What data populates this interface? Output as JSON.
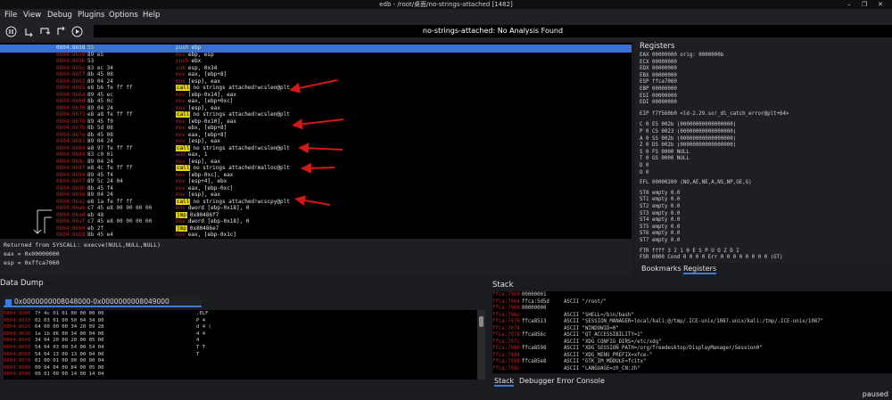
{
  "window": {
    "title": "edb - /root/桌面/no-strings-attached [1482]",
    "minimize": "–",
    "restore": "❐",
    "close": "✕"
  },
  "menu": [
    "File",
    "View",
    "Debug",
    "Plugins",
    "Options",
    "Help"
  ],
  "toolbar": {
    "status": "no-strings-attached: No Analysis Found"
  },
  "code": [
    {
      "addr": "0804:8658",
      "bytes": "55",
      "mnem": "push",
      "ops": "ebp",
      "sel": true
    },
    {
      "addr": "0804:8659",
      "bytes": "89 e5",
      "mnem": "mov",
      "ops": "ebp, esp"
    },
    {
      "addr": "0804:865b",
      "bytes": "53",
      "mnem": "push",
      "ops": "ebx"
    },
    {
      "addr": "0804:865c",
      "bytes": "83 ec 34",
      "mnem": "sub",
      "ops": "esp, 0x34"
    },
    {
      "addr": "0804:865f",
      "bytes": "8b 45 08",
      "mnem": "mov",
      "ops": "eax, [ebp+8]"
    },
    {
      "addr": "0804:8662",
      "bytes": "89 04 24",
      "mnem": "mov",
      "ops": "[esp], eax"
    },
    {
      "addr": "0804:8665",
      "bytes": "e8 b6 fe ff ff",
      "call": "call",
      "sym": "no strings attached!wcslen@plt"
    },
    {
      "addr": "0804:866a",
      "bytes": "89 45 ec",
      "mnem": "mov",
      "ops": "[ebp-0x14], eax"
    },
    {
      "addr": "0804:866d",
      "bytes": "8b 45 0c",
      "mnem": "mov",
      "ops": "eax, [ebp+0xc]"
    },
    {
      "addr": "0804:8670",
      "bytes": "89 04 24",
      "mnem": "mov",
      "ops": "[esp], eax"
    },
    {
      "addr": "0804:8673",
      "bytes": "e8 a8 fe ff ff",
      "call": "call",
      "sym": "no strings attached!wcslen@plt"
    },
    {
      "addr": "0804:8678",
      "bytes": "89 45 f0",
      "mnem": "mov",
      "ops": "[ebp-0x10], eax"
    },
    {
      "addr": "0804:867b",
      "bytes": "8b 5d 08",
      "mnem": "mov",
      "ops": "ebx, [ebp+8]"
    },
    {
      "addr": "0804:867e",
      "bytes": "8b 45 08",
      "mnem": "mov",
      "ops": "eax, [ebp+8]"
    },
    {
      "addr": "0804:8681",
      "bytes": "89 04 24",
      "mnem": "mov",
      "ops": "[esp], eax"
    },
    {
      "addr": "0804:8684",
      "bytes": "e8 97 fe ff ff",
      "call": "call",
      "sym": "no strings attached!wcslen@plt"
    },
    {
      "addr": "0804:8689",
      "bytes": "83 c0 01",
      "mnem": "add",
      "ops": "eax, 1"
    },
    {
      "addr": "0804:868c",
      "bytes": "89 04 24",
      "mnem": "mov",
      "ops": "[esp], eax"
    },
    {
      "addr": "0804:868f",
      "bytes": "e8 4c fe ff ff",
      "call": "call",
      "sym": "no strings attached!malloc@plt"
    },
    {
      "addr": "0804:8694",
      "bytes": "89 45 f4",
      "mnem": "mov",
      "ops": "[ebp-0xc], eax"
    },
    {
      "addr": "0804:8697",
      "bytes": "89 5c 24 04",
      "mnem": "mov",
      "ops": "[esp+4], ebx"
    },
    {
      "addr": "0804:869b",
      "bytes": "8b 45 f4",
      "mnem": "mov",
      "ops": "eax, [ebp-0xc]"
    },
    {
      "addr": "0804:869e",
      "bytes": "89 04 24",
      "mnem": "mov",
      "ops": "[esp], eax"
    },
    {
      "addr": "0804:86a1",
      "bytes": "e8 1a fe ff ff",
      "call": "call",
      "sym": "no strings attached!wcscpy@plt"
    },
    {
      "addr": "0804:86a6",
      "bytes": "c7 45 e8 00 00 00 00",
      "mnem": "mov",
      "ops": "dword [ebp-0x18], 0"
    },
    {
      "addr": "0804:86ad",
      "bytes": "eb 48",
      "jmp": "jmp",
      "ops": "0x80486f7"
    },
    {
      "addr": "0804:86af",
      "bytes": "c7 45 e8 00 00 00 00",
      "mnem": "mov",
      "ops": "dword [ebp-0x18], 0"
    },
    {
      "addr": "0804:86b6",
      "bytes": "eb 2f",
      "jmp": "jmp",
      "ops": "0x80486e7"
    },
    {
      "addr": "0804:86b8",
      "bytes": "8b 45 e4",
      "mnem": "mov",
      "ops": "eax, [ebp-0x1c]"
    }
  ],
  "returned": {
    "line1": "Returned from SYSCALL: execve(NULL,NULL,NULL)",
    "line2": "eax = 0x00000000",
    "line3": "esp = 0xffca7060"
  },
  "registers": {
    "title": "Registers",
    "gp": [
      "EAX  00000000  orig: 0000000b",
      "ECX  00000000",
      "EDX  00000000",
      "EBX  00000000",
      "ESP  ffca7060",
      "EBP  00000000",
      "ESI  00000000",
      "EDI  00000000"
    ],
    "eip": "EIP  f7f560b0  <ld-2.29.so!_dl_catch_error@plt+64>",
    "flags": [
      "C  0   ES  002b  (00000000000000000)",
      "P  0   CS  0023  (00000000000000000)",
      "A  0   SS  002b  (00000000000000000)",
      "Z  0   DS  002b  (00000000000000000)",
      "S  0   FS  0000  NULL",
      "T  0   GS  0000  NULL",
      "D  0",
      "O  0"
    ],
    "efl": "EFL  00000200  (NO,AE,NE,A,NS,NP,GE,G)",
    "st": [
      "ST0  empty    0.0",
      "ST1  empty    0.0",
      "ST2  empty    0.0",
      "ST3  empty    0.0",
      "ST4  empty    0.0",
      "ST5  empty    0.0",
      "ST6  empty    0.0",
      "ST7  empty    0.0"
    ],
    "ftr": "FTR  ffff        3 2 1 0      E S P U O Z D I",
    "fsr": "FSR  0000   Cond  0 0 0 0   Err  0 0 0 0 0 0 0 0  (GT)"
  },
  "reg_tabs": [
    "Bookmarks",
    "Registers"
  ],
  "dump": {
    "title": "Data Dump",
    "tab": "0x0000000008048000-0x0000000008049000",
    "rows": [
      {
        "addr": "0804:8000",
        "hex": "7f  4c  01  01  00  00  00  00",
        "asc": ".ELF"
      },
      {
        "addr": "0804:8010",
        "hex": "02  03  01  00  50  04  34  00",
        "asc": "        P   4"
      },
      {
        "addr": "0804:8020",
        "hex": "64  00  00  00  34  20  09  28",
        "asc": "d       4   ("
      },
      {
        "addr": "0804:8030",
        "hex": "1e  1b  06  00  34  00  04  00",
        "asc": "        4   4"
      },
      {
        "addr": "0804:8040",
        "hex": "34  04  20  00  20  00  05  00",
        "asc": "4"
      },
      {
        "addr": "0804:8050",
        "hex": "54  04  03  00  54  00  54  04",
        "asc": "    T   T"
      },
      {
        "addr": "0804:8060",
        "hex": "54  04  13  00  13  00  04  00",
        "asc": "T"
      },
      {
        "addr": "0804:8070",
        "hex": "01  00  01  00  00  00  00  04",
        "asc": ""
      },
      {
        "addr": "0804:8080",
        "hex": "00  04  04  00  84  00  05  00",
        "asc": ""
      },
      {
        "addr": "0804:8090",
        "hex": "00  01  00  00  14  00  14  04",
        "asc": ""
      }
    ]
  },
  "stack": {
    "title": "Stack",
    "rows": [
      {
        "addr": "ffca:7060",
        "val": "00000001",
        "cmt": ""
      },
      {
        "addr": "ffca:7064",
        "val": "ffca:5d5d",
        "cmt": "ASCII \"/root/\""
      },
      {
        "addr": "ffca:7068",
        "val": "00000000",
        "cmt": ""
      },
      {
        "addr": "ffca:706c",
        "val": "",
        "cmt": "ASCII \"SHELL=/bin/bash\""
      },
      {
        "addr": "ffca:7070",
        "val": "ffca8513",
        "cmt": "ASCII \"SESSION_MANAGER=local/kali:@/tmp/.ICE-unix/1087.unix/kali:/tmp/.ICE-unix/1087\""
      },
      {
        "addr": "ffca:7074",
        "val": "",
        "cmt": "ASCII \"WINDOWID=0\""
      },
      {
        "addr": "ffca:7078",
        "val": "ffca856c",
        "cmt": "ASCII \"QT_ACCESSIBILITY=1\""
      },
      {
        "addr": "ffca:707c",
        "val": "",
        "cmt": "ASCII \"XDG_CONFIG_DIRS=/etc/xdg\""
      },
      {
        "addr": "ffca:7080",
        "val": "ffca8598",
        "cmt": "ASCII \"XDG_SESSION_PATH=/org/freedesktop/DisplayManager/Session0\""
      },
      {
        "addr": "ffca:7084",
        "val": "",
        "cmt": "ASCII \"XDG_MENU_PREFIX=xfce-\""
      },
      {
        "addr": "ffca:7088",
        "val": "ffca85e8",
        "cmt": "ASCII \"GTK_IM_MODULE=fcitx\""
      },
      {
        "addr": "ffca:708c",
        "val": "",
        "cmt": "ASCII \"LANGUAGE=zh_CN:zh\""
      }
    ],
    "tabs": [
      "Stack",
      "Debugger Error Console"
    ]
  },
  "bottom": {
    "status": "paused"
  }
}
